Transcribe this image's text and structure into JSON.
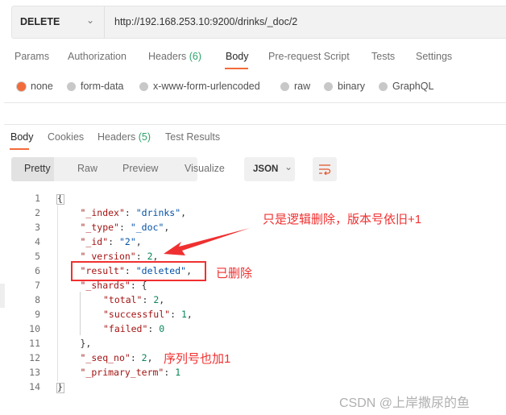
{
  "request": {
    "method": "DELETE",
    "url": "http://192.168.253.10:9200/drinks/_doc/2"
  },
  "request_tabs": [
    {
      "label": "Params"
    },
    {
      "label": "Authorization"
    },
    {
      "label": "Headers",
      "count": "(6)"
    },
    {
      "label": "Body",
      "active": true
    },
    {
      "label": "Pre-request Script"
    },
    {
      "label": "Tests"
    },
    {
      "label": "Settings"
    }
  ],
  "body_types": [
    {
      "label": "none",
      "selected": true
    },
    {
      "label": "form-data"
    },
    {
      "label": "x-www-form-urlencoded"
    },
    {
      "label": "raw"
    },
    {
      "label": "binary"
    },
    {
      "label": "GraphQL"
    }
  ],
  "response_tabs": [
    {
      "label": "Body",
      "active": true
    },
    {
      "label": "Cookies"
    },
    {
      "label": "Headers",
      "count": "(5)"
    },
    {
      "label": "Test Results"
    }
  ],
  "view_modes": [
    {
      "label": "Pretty",
      "active": true
    },
    {
      "label": "Raw"
    },
    {
      "label": "Preview"
    },
    {
      "label": "Visualize"
    }
  ],
  "format": "JSON",
  "icons": {
    "method_dropdown": "chevron-down-icon",
    "format_dropdown": "chevron-down-icon",
    "wrap": "wrap-lines-icon"
  },
  "colors": {
    "accent": "#f26b3a",
    "annotation": "#f03030"
  },
  "code_lines": [
    {
      "n": "1",
      "indent": 0,
      "parts": [
        [
          "p",
          "{"
        ]
      ]
    },
    {
      "n": "2",
      "indent": 1,
      "parts": [
        [
          "k",
          "\"_index\""
        ],
        [
          "p",
          ": "
        ],
        [
          "s",
          "\"drinks\""
        ],
        [
          "p",
          ","
        ]
      ]
    },
    {
      "n": "3",
      "indent": 1,
      "parts": [
        [
          "k",
          "\"_type\""
        ],
        [
          "p",
          ": "
        ],
        [
          "s",
          "\"_doc\""
        ],
        [
          "p",
          ","
        ]
      ]
    },
    {
      "n": "4",
      "indent": 1,
      "parts": [
        [
          "k",
          "\"_id\""
        ],
        [
          "p",
          ": "
        ],
        [
          "s",
          "\"2\""
        ],
        [
          "p",
          ","
        ]
      ]
    },
    {
      "n": "5",
      "indent": 1,
      "parts": [
        [
          "k",
          "\"_version\""
        ],
        [
          "p",
          ": "
        ],
        [
          "n",
          "2"
        ],
        [
          "p",
          ","
        ]
      ]
    },
    {
      "n": "6",
      "indent": 1,
      "parts": [
        [
          "k",
          "\"result\""
        ],
        [
          "p",
          ": "
        ],
        [
          "s",
          "\"deleted\""
        ],
        [
          "p",
          ","
        ]
      ]
    },
    {
      "n": "7",
      "indent": 1,
      "parts": [
        [
          "k",
          "\"_shards\""
        ],
        [
          "p",
          ": {"
        ]
      ]
    },
    {
      "n": "8",
      "indent": 2,
      "parts": [
        [
          "k",
          "\"total\""
        ],
        [
          "p",
          ": "
        ],
        [
          "n",
          "2"
        ],
        [
          "p",
          ","
        ]
      ]
    },
    {
      "n": "9",
      "indent": 2,
      "parts": [
        [
          "k",
          "\"successful\""
        ],
        [
          "p",
          ": "
        ],
        [
          "n",
          "1"
        ],
        [
          "p",
          ","
        ]
      ]
    },
    {
      "n": "10",
      "indent": 2,
      "parts": [
        [
          "k",
          "\"failed\""
        ],
        [
          "p",
          ": "
        ],
        [
          "n",
          "0"
        ]
      ]
    },
    {
      "n": "11",
      "indent": 1,
      "parts": [
        [
          "p",
          "},"
        ]
      ]
    },
    {
      "n": "12",
      "indent": 1,
      "parts": [
        [
          "k",
          "\"_seq_no\""
        ],
        [
          "p",
          ": "
        ],
        [
          "n",
          "2"
        ],
        [
          "p",
          ","
        ]
      ]
    },
    {
      "n": "13",
      "indent": 1,
      "parts": [
        [
          "k",
          "\"_primary_term\""
        ],
        [
          "p",
          ": "
        ],
        [
          "n",
          "1"
        ]
      ]
    },
    {
      "n": "14",
      "indent": 0,
      "parts": [
        [
          "p",
          "}"
        ]
      ]
    }
  ],
  "annotations": {
    "version": "只是逻辑删除，版本号依旧+1",
    "deleted": "已删除",
    "seq_no": "序列号也加1"
  },
  "watermark": "CSDN @上岸撒尿的鱼"
}
